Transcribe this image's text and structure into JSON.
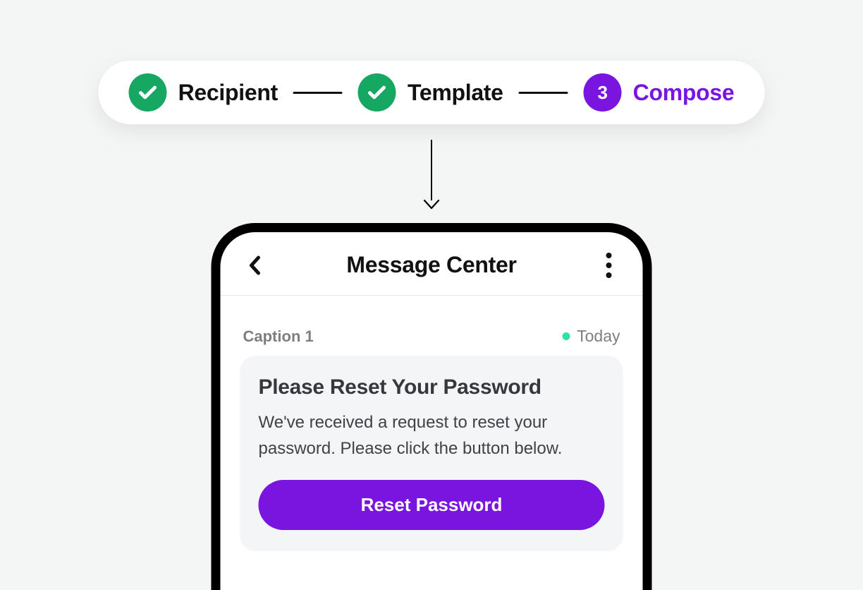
{
  "stepper": {
    "steps": [
      {
        "label": "Recipient",
        "state": "done"
      },
      {
        "label": "Template",
        "state": "done"
      },
      {
        "label": "Compose",
        "state": "active",
        "number": "3"
      }
    ]
  },
  "phone": {
    "appbar": {
      "title": "Message Center"
    },
    "meta": {
      "caption": "Caption 1",
      "date": "Today"
    },
    "message": {
      "title": "Please Reset Your Password",
      "body": "We've received a request to reset your password. Please click the button below.",
      "cta_label": "Reset Password"
    }
  },
  "colors": {
    "accent_purple": "#7a15e0",
    "done_green": "#16a862",
    "status_dot": "#2de3a0"
  }
}
